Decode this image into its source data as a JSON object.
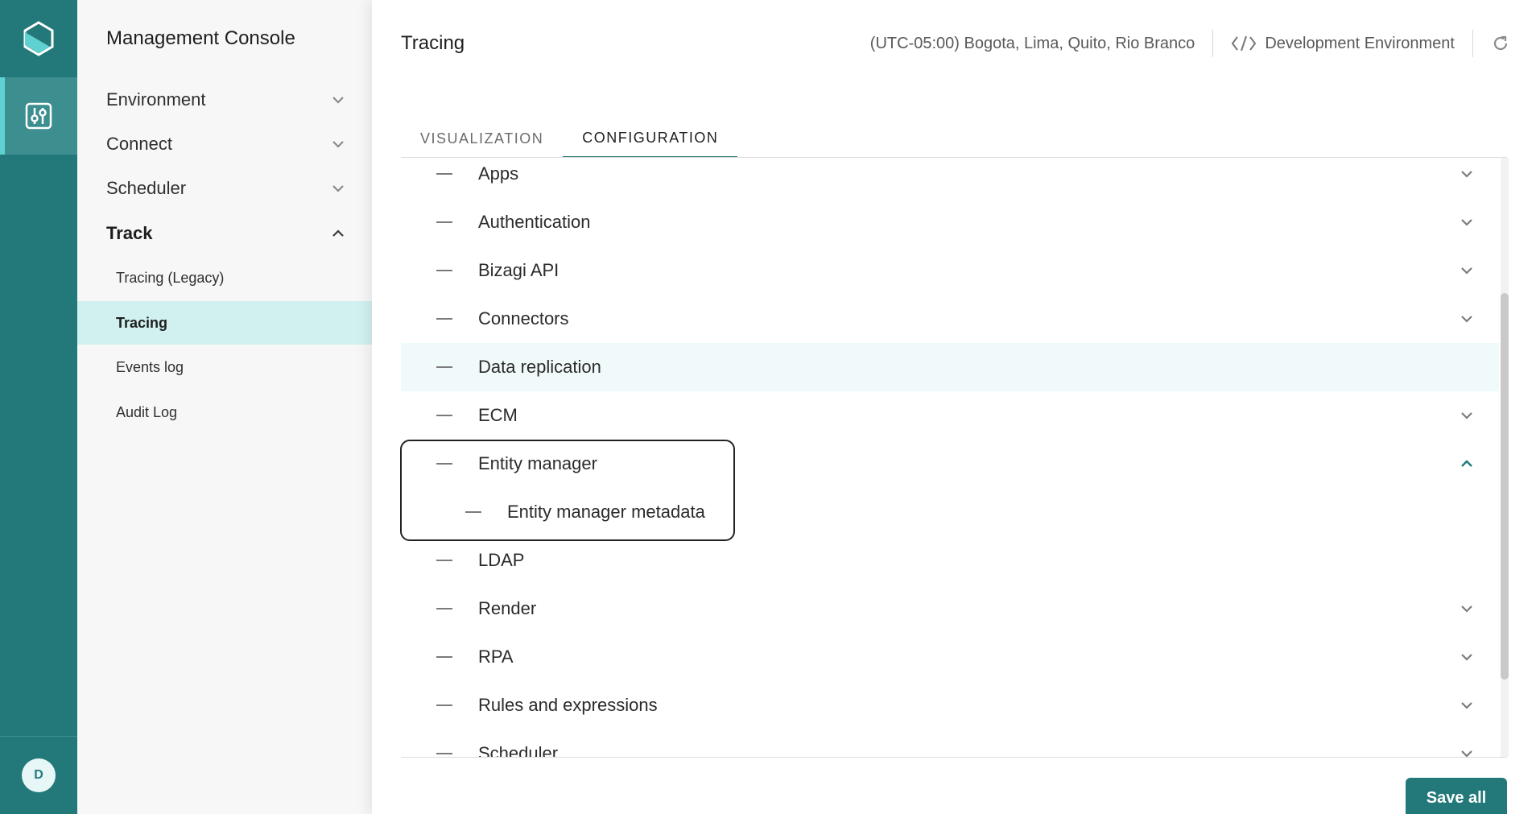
{
  "avatar": {
    "initial": "D"
  },
  "sidebar": {
    "title": "Management Console",
    "groups": [
      {
        "label": "Environment",
        "expanded": false
      },
      {
        "label": "Connect",
        "expanded": false
      },
      {
        "label": "Scheduler",
        "expanded": false
      },
      {
        "label": "Track",
        "expanded": true
      }
    ],
    "track_items": [
      {
        "label": "Tracing (Legacy)",
        "selected": false
      },
      {
        "label": "Tracing",
        "selected": true
      },
      {
        "label": "Events log",
        "selected": false
      },
      {
        "label": "Audit Log",
        "selected": false
      }
    ]
  },
  "header": {
    "title": "Tracing",
    "timezone": "(UTC-05:00) Bogota, Lima, Quito, Rio Branco",
    "environment": "Development Environment"
  },
  "tabs": [
    {
      "label": "VISUALIZATION",
      "active": false
    },
    {
      "label": "CONFIGURATION",
      "active": true
    }
  ],
  "config_list": [
    {
      "label": "Apps",
      "chevron": "down"
    },
    {
      "label": "Authentication",
      "chevron": "down"
    },
    {
      "label": "Bizagi API",
      "chevron": "down"
    },
    {
      "label": "Connectors",
      "chevron": "down"
    },
    {
      "label": "Data replication",
      "chevron": "none",
      "hover": true
    },
    {
      "label": "ECM",
      "chevron": "down"
    },
    {
      "label": "Entity manager",
      "chevron": "up"
    },
    {
      "label": "Entity manager metadata",
      "chevron": "none",
      "child": true
    },
    {
      "label": "LDAP",
      "chevron": "none"
    },
    {
      "label": "Render",
      "chevron": "down"
    },
    {
      "label": "RPA",
      "chevron": "down"
    },
    {
      "label": "Rules and expressions",
      "chevron": "down"
    },
    {
      "label": "Scheduler",
      "chevron": "down"
    }
  ],
  "actions": {
    "save_label": "Save all"
  },
  "colors": {
    "brand": "#23797a",
    "accent": "#5fd1d1",
    "selected_bg": "#d1f0f0"
  }
}
